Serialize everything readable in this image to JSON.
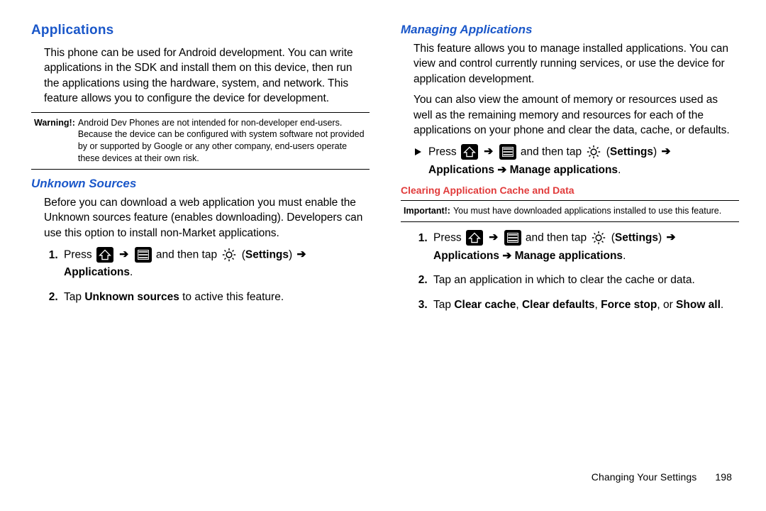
{
  "left": {
    "h1": "Applications",
    "intro": "This phone can be used for Android development. You can write applications in the SDK and install them on this device, then run the applications using the hardware, system, and network. This feature allows you to configure the device for development.",
    "warn_label": "Warning!:",
    "warn_body": "Android Dev Phones are not intended for non-developer end-users. Because the device can be configured with system software not provided by or supported by Google or any other company, end-users operate these devices at their own risk.",
    "h_unknown": "Unknown Sources",
    "unknown_intro": "Before you can download a web application you must enable the Unknown sources feature (enables downloading). Developers can use this option to install non-Market applications.",
    "step1_press": "Press ",
    "step1_andthen": " and then tap ",
    "step1_settings_open": " (",
    "step1_settings": "Settings",
    "step1_settings_close": ") ",
    "step1_applications": "Applications",
    "step1_period": ".",
    "step2_pre": "Tap ",
    "step2_bold": "Unknown sources",
    "step2_post": " to active this feature."
  },
  "right": {
    "h_manage": "Managing Applications",
    "p1": "This feature allows you to manage installed applications. You can view and control currently running services, or use the device for application development.",
    "p2": "You can also view the amount of memory or resources used as well as the remaining memory and resources for each of the applications on your phone and clear the data, cache, or defaults.",
    "bullet_press": "Press ",
    "bullet_andthen": " and then tap ",
    "bullet_settings_open": " (",
    "bullet_settings": "Settings",
    "bullet_settings_close": ") ",
    "bullet_apps": "Applications  ➔ Manage applications",
    "bullet_period": ".",
    "h_clearing": "Clearing Application Cache and Data",
    "imp_label": "Important!:",
    "imp_body": "You must have downloaded applications installed to use this feature.",
    "step1_press": "Press ",
    "step1_andthen": " and then tap ",
    "step1_settings_open": " (",
    "step1_settings": "Settings",
    "step1_settings_close": ") ",
    "step1_apps": "Applications ➔ Manage applications",
    "step1_period": ".",
    "step2": "Tap an application in which to clear the cache or data.",
    "step3_pre": "Tap ",
    "step3_b1": "Clear cache",
    "step3_c1": ", ",
    "step3_b2": "Clear defaults",
    "step3_c2": ", ",
    "step3_b3": "Force stop",
    "step3_c3": ", or ",
    "step3_b4": "Show all",
    "step3_period": "."
  },
  "footer_text": "Changing Your Settings",
  "footer_page": "198",
  "arrow_glyph": "➔"
}
